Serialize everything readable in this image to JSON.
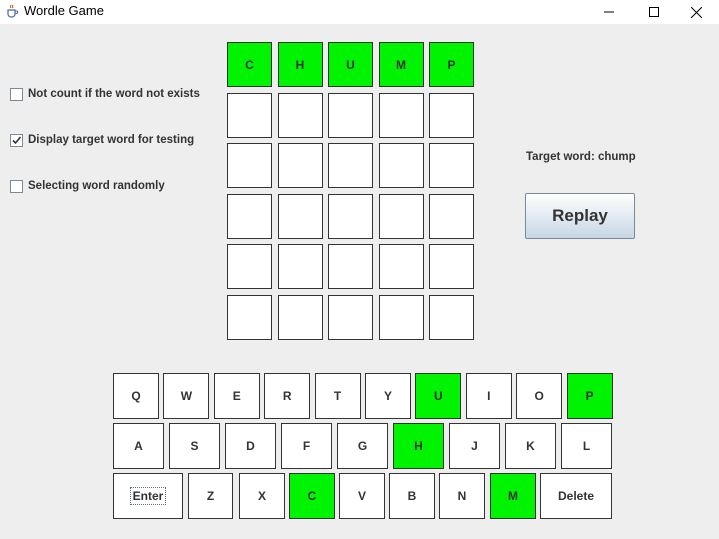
{
  "window": {
    "title": "Wordle Game",
    "icon": "java-cup-icon"
  },
  "options": [
    {
      "label": "Not count if the word not exists",
      "checked": false
    },
    {
      "label": "Display target word for testing",
      "checked": true
    },
    {
      "label": "Selecting word randomly",
      "checked": false
    }
  ],
  "board": {
    "rows": [
      [
        "C",
        "H",
        "U",
        "M",
        "P"
      ],
      [
        "",
        "",
        "",
        "",
        ""
      ],
      [
        "",
        "",
        "",
        "",
        ""
      ],
      [
        "",
        "",
        "",
        "",
        ""
      ],
      [
        "",
        "",
        "",
        "",
        ""
      ],
      [
        "",
        "",
        "",
        "",
        ""
      ]
    ],
    "correct_row": 0
  },
  "target_text": "Target word: chump",
  "replay_label": "Replay",
  "keyboard": {
    "row1": [
      "Q",
      "W",
      "E",
      "R",
      "T",
      "Y",
      "U",
      "I",
      "O",
      "P"
    ],
    "row2": [
      "A",
      "S",
      "D",
      "F",
      "G",
      "H",
      "J",
      "K",
      "L"
    ],
    "row3": [
      "Enter",
      "Z",
      "X",
      "C",
      "V",
      "B",
      "N",
      "M",
      "Delete"
    ],
    "green_keys": [
      "U",
      "P",
      "H",
      "C",
      "M"
    ]
  },
  "colors": {
    "correct": "#00f300",
    "background": "#eeeeee"
  }
}
